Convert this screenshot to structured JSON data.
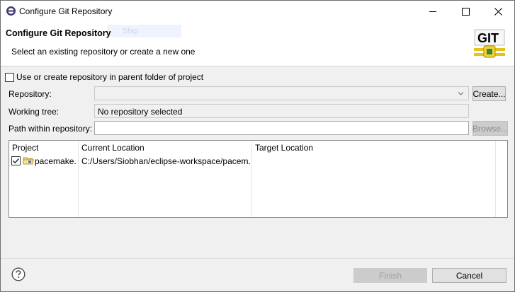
{
  "window": {
    "title": "Configure Git Repository"
  },
  "header": {
    "title": "Configure Git Repository",
    "subtitle": "Select an existing repository or create a new one",
    "ghost_text": "Ship",
    "logo_text": "GIT"
  },
  "form": {
    "parent_folder_checkbox_label": "Use or create repository in parent folder of project",
    "parent_folder_checked": false,
    "repository_label": "Repository:",
    "repository_value": "",
    "create_button": "Create...",
    "working_tree_label": "Working tree:",
    "working_tree_value": "No repository selected",
    "path_label": "Path within repository:",
    "path_value": "",
    "browse_button": "Browse..."
  },
  "table": {
    "columns": [
      "Project",
      "Current Location",
      "Target Location"
    ],
    "rows": [
      {
        "checked": true,
        "project": "pacemake...",
        "current_location": "C:/Users/Siobhan/eclipse-workspace/pacem...",
        "target_location": ""
      }
    ]
  },
  "footer": {
    "finish_button": "Finish",
    "cancel_button": "Cancel"
  },
  "colors": {
    "window_bg": "#f0f0f0",
    "header_bg": "#ffffff",
    "disabled_button": "#cccccc",
    "git_logo_red": "#d33f2e",
    "git_logo_green": "#2e8b3a",
    "git_logo_yellow": "#e8c21a"
  },
  "icons": {
    "app": "eclipse-icon",
    "minimize": "minimize-icon",
    "maximize": "maximize-icon",
    "close": "close-icon",
    "logo": "git-logo",
    "folder": "project-folder-icon",
    "help": "help-icon",
    "dropdown": "chevron-down-icon"
  }
}
